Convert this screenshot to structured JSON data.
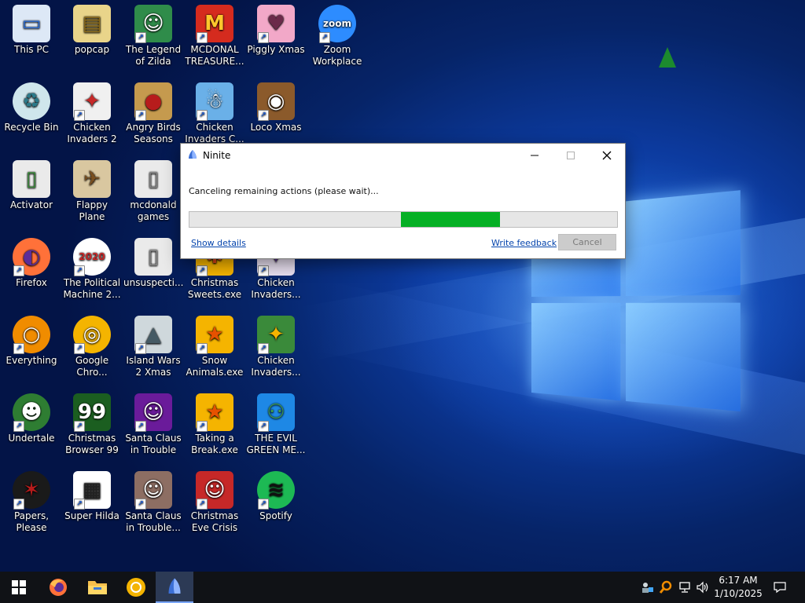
{
  "desktop": {
    "icons": [
      {
        "label": "This PC",
        "icon": "computer-icon",
        "bg": "#dde8f6",
        "fg": "#2a6bd1",
        "shortcut": false
      },
      {
        "label": "popcap",
        "icon": "folder-icon",
        "bg": "#e9d48a",
        "fg": "#8a6a1a",
        "shortcut": false
      },
      {
        "label": "The Legend of Zilda",
        "icon": "game-hero-icon",
        "bg": "#2f8c4a",
        "fg": "#ffffff",
        "shortcut": true
      },
      {
        "label": "MCDONAL TREASURE...",
        "icon": "mcdonalds-icon",
        "bg": "#d52b1e",
        "fg": "#ffc72c",
        "shortcut": true
      },
      {
        "label": "Piggly Xmas",
        "icon": "pig-icon",
        "bg": "#f2a8c8",
        "fg": "#6b2a4a",
        "shortcut": true
      },
      {
        "label": "Zoom Workplace",
        "icon": "zoom-icon",
        "bg": "#2d8cff",
        "fg": "#ffffff",
        "shortcut": true
      },
      {
        "label": "Recycle Bin",
        "icon": "recycle-bin-icon",
        "bg": "#cfe6ec",
        "fg": "#2c7a8a",
        "shortcut": false
      },
      {
        "label": "Chicken Invaders 2",
        "icon": "chicken-icon",
        "bg": "#f0f0f0",
        "fg": "#c62828",
        "shortcut": true
      },
      {
        "label": "Angry Birds Seasons",
        "icon": "angry-bird-icon",
        "bg": "#c59a4e",
        "fg": "#b71c1c",
        "shortcut": true
      },
      {
        "label": "Chicken Invaders C...",
        "icon": "snowman-icon",
        "bg": "#6ab0e8",
        "fg": "#ffffff",
        "shortcut": true
      },
      {
        "label": "Loco Xmas",
        "icon": "bear-icon",
        "bg": "#8b5a2b",
        "fg": "#ffffff",
        "shortcut": true
      },
      {
        "label": "Activator",
        "icon": "file-icon",
        "bg": "#eaeaea",
        "fg": "#3a8a3a",
        "shortcut": false
      },
      {
        "label": "Flappy Plane",
        "icon": "plane-icon",
        "bg": "#d9c7a0",
        "fg": "#7a5020",
        "shortcut": false
      },
      {
        "label": "mcdonald games",
        "icon": "file-icon",
        "bg": "#eaeaea",
        "fg": "#888888",
        "shortcut": false
      },
      {
        "label": "Firefox",
        "icon": "firefox-icon",
        "bg": "#ff7139",
        "fg": "#5a2d9a",
        "shortcut": true
      },
      {
        "label": "The Political Machine 2...",
        "icon": "political-icon",
        "bg": "#ffffff",
        "fg": "#c62828",
        "shortcut": true
      },
      {
        "label": "unsuspecti...",
        "icon": "file-icon",
        "bg": "#eaeaea",
        "fg": "#888888",
        "shortcut": false
      },
      {
        "label": "Christmas Sweets.exe",
        "icon": "sweets-icon",
        "bg": "#f5b400",
        "fg": "#d84315",
        "shortcut": true
      },
      {
        "label": "Chicken Invaders...",
        "icon": "chicken-icon",
        "bg": "#e9e0f0",
        "fg": "#5a2d9a",
        "shortcut": true
      },
      {
        "label": "Everything",
        "icon": "search-icon",
        "bg": "#f08c00",
        "fg": "#ffffff",
        "shortcut": true
      },
      {
        "label": "Google Chro...",
        "icon": "chrome-icon",
        "bg": "#f4b400",
        "fg": "#ffffff",
        "shortcut": true
      },
      {
        "label": "Island Wars 2 Xmas",
        "icon": "island-icon",
        "bg": "#cfd8dc",
        "fg": "#455a64",
        "shortcut": true
      },
      {
        "label": "Snow Animals.exe",
        "icon": "star-icon",
        "bg": "#f5b400",
        "fg": "#e65100",
        "shortcut": true
      },
      {
        "label": "Chicken Invaders...",
        "icon": "chicken-icon",
        "bg": "#3a8a3a",
        "fg": "#f5b400",
        "shortcut": true
      },
      {
        "label": "Undertale",
        "icon": "undertale-icon",
        "bg": "#2e7d32",
        "fg": "#ffffff",
        "shortcut": true
      },
      {
        "label": "Christmas Browser 99",
        "icon": "xmas-tree-icon",
        "bg": "#1b5e20",
        "fg": "#ffffff",
        "shortcut": true
      },
      {
        "label": "Santa Claus in Trouble",
        "icon": "santa-icon",
        "bg": "#6a1b9a",
        "fg": "#ffffff",
        "shortcut": true
      },
      {
        "label": "Taking a Break.exe",
        "icon": "star-icon",
        "bg": "#f5b400",
        "fg": "#e65100",
        "shortcut": true
      },
      {
        "label": "THE EVIL GREEN ME...",
        "icon": "messenger-icon",
        "bg": "#1e88e5",
        "fg": "#43a047",
        "shortcut": true
      },
      {
        "label": "Papers, Please",
        "icon": "papers-please-icon",
        "bg": "#1a1a1a",
        "fg": "#b71c1c",
        "shortcut": true
      },
      {
        "label": "Super Hilda",
        "icon": "pixel-dog-icon",
        "bg": "#ffffff",
        "fg": "#222222",
        "shortcut": true
      },
      {
        "label": "Santa Claus in Trouble... A...",
        "icon": "santa-icon",
        "bg": "#8d6e63",
        "fg": "#ffffff",
        "shortcut": true
      },
      {
        "label": "Christmas Eve Crisis",
        "icon": "santa-icon",
        "bg": "#c62828",
        "fg": "#ffffff",
        "shortcut": true
      },
      {
        "label": "Spotify",
        "icon": "spotify-icon",
        "bg": "#1db954",
        "fg": "#111111",
        "shortcut": true
      }
    ]
  },
  "dialog": {
    "title": "Ninite",
    "status": "Canceling remaining actions (please wait)...",
    "progress_start": 0.495,
    "progress_end": 0.727,
    "show_details": "Show details",
    "write_feedback": "Write feedback",
    "cancel": "Cancel",
    "accent": "#06b025"
  },
  "taskbar": {
    "time": "6:17 AM",
    "date": "1/10/2025",
    "items": [
      "windows-start-icon",
      "firefox-icon",
      "file-explorer-icon",
      "chrome-icon",
      "ninite-icon"
    ]
  }
}
